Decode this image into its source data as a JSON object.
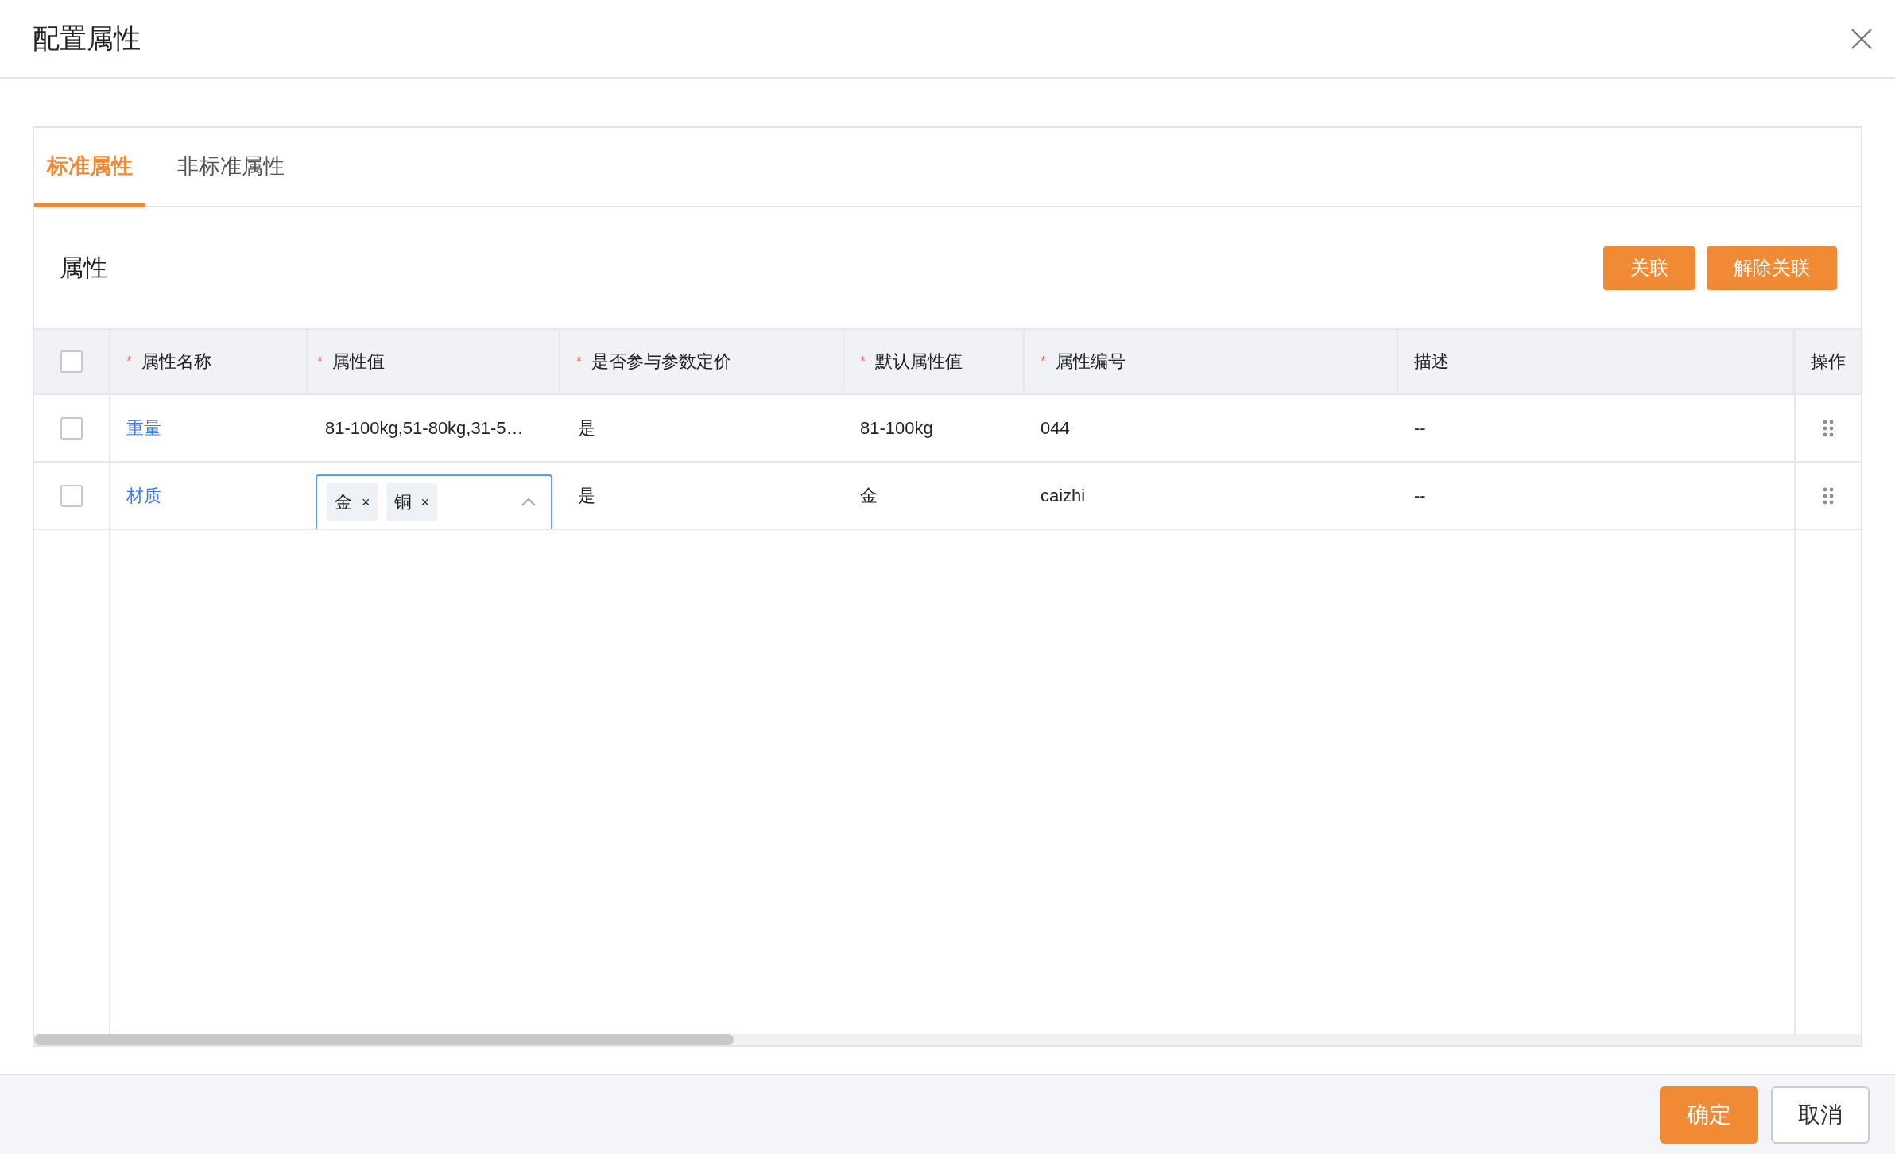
{
  "dialog": {
    "title": "配置属性"
  },
  "tabs": [
    {
      "label": "标准属性",
      "selected": true
    },
    {
      "label": "非标准属性",
      "selected": false
    }
  ],
  "section": {
    "title": "属性",
    "buttons": [
      "关联",
      "解除关联"
    ]
  },
  "table": {
    "header_checked": false,
    "columns": [
      {
        "marker": "*",
        "label": "属性名称"
      },
      {
        "marker": "*",
        "label": "属性值"
      },
      {
        "marker": "*",
        "label": "是否参与参数定价"
      },
      {
        "marker": "*",
        "label": "默认属性值"
      },
      {
        "marker": "*",
        "label": "属性编号"
      },
      {
        "label": "描述"
      },
      {
        "label": "操作"
      }
    ],
    "rows": [
      {
        "checked": false,
        "name": "重量",
        "value": {
          "kind": "text",
          "text": "81-100kg,51-80kg,31-5…"
        },
        "pricing": "是",
        "default": "81-100kg",
        "code": "044",
        "description": "--"
      },
      {
        "checked": false,
        "name": "材质",
        "value": {
          "kind": "select",
          "tags": [
            "金",
            "铜"
          ],
          "remove": "×",
          "expanded": true
        },
        "pricing": "是",
        "default": "金",
        "code": "caizhi",
        "description": "--"
      }
    ]
  },
  "footer": {
    "buttons": [
      {
        "label": "确定",
        "kind": "primary"
      },
      {
        "label": "取消",
        "kind": "default"
      }
    ]
  }
}
